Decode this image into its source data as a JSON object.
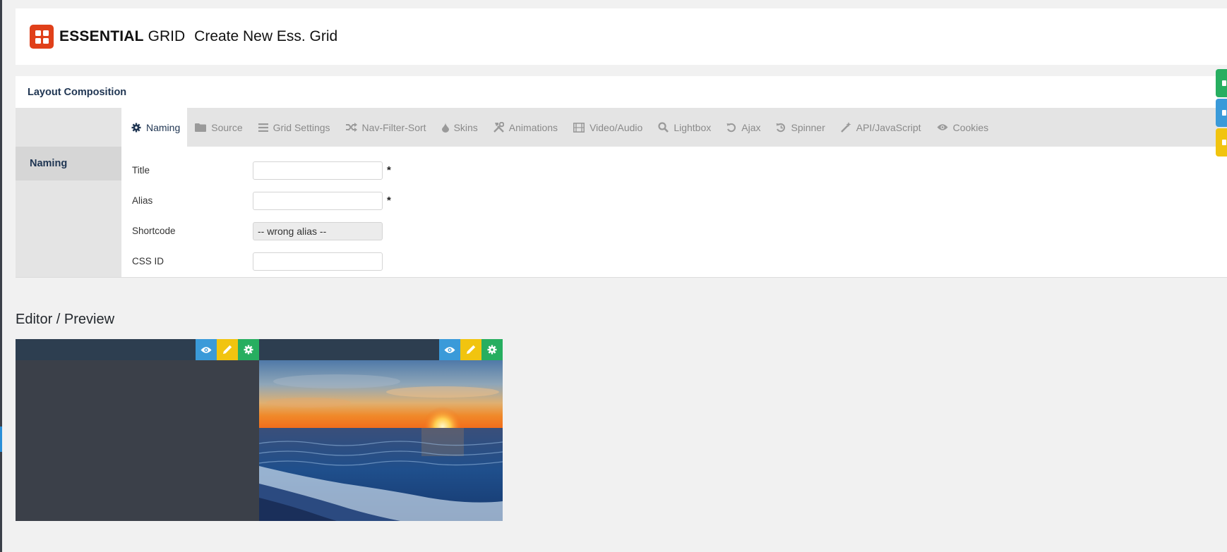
{
  "header": {
    "brand_strong": "ESSENTIAL",
    "brand_light": "GRID",
    "page_title": "Create New Ess. Grid"
  },
  "panel": {
    "title": "Layout Composition",
    "tabs": [
      {
        "label": "Naming",
        "icon": "gear-icon",
        "active": true
      },
      {
        "label": "Source",
        "icon": "folder-icon"
      },
      {
        "label": "Grid Settings",
        "icon": "menu-icon"
      },
      {
        "label": "Nav-Filter-Sort",
        "icon": "shuffle-icon"
      },
      {
        "label": "Skins",
        "icon": "drop-icon"
      },
      {
        "label": "Animations",
        "icon": "tools-icon"
      },
      {
        "label": "Video/Audio",
        "icon": "film-icon"
      },
      {
        "label": "Lightbox",
        "icon": "search-icon"
      },
      {
        "label": "Ajax",
        "icon": "refresh-icon"
      },
      {
        "label": "Spinner",
        "icon": "history-icon"
      },
      {
        "label": "API/JavaScript",
        "icon": "magic-wand-icon"
      },
      {
        "label": "Cookies",
        "icon": "eye-icon"
      }
    ],
    "sidebar": {
      "active_item": "Naming"
    },
    "form": {
      "title_label": "Title",
      "title_value": "",
      "alias_label": "Alias",
      "alias_value": "",
      "shortcode_label": "Shortcode",
      "shortcode_value": "-- wrong alias --",
      "cssid_label": "CSS ID",
      "cssid_value": "",
      "required_mark": "*"
    }
  },
  "editor": {
    "title": "Editor / Preview",
    "cards": [
      {
        "has_image": false
      },
      {
        "has_image": true,
        "image": "sunset over ocean waves"
      }
    ]
  },
  "colors": {
    "brand": "#e0401a",
    "eye_button": "#3a9ad9",
    "edit_button": "#f1c40f",
    "settings_button": "#27ae60",
    "card_bar": "#2d3e50",
    "card_body": "#3b4049"
  }
}
